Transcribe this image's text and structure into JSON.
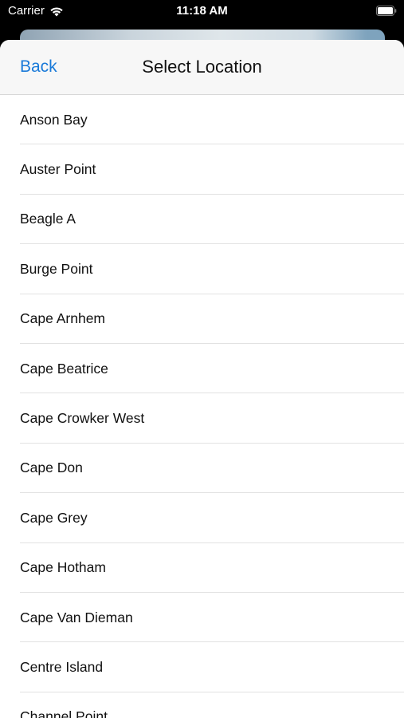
{
  "status_bar": {
    "carrier": "Carrier",
    "time": "11:18 AM"
  },
  "nav": {
    "back_label": "Back",
    "title": "Select Location"
  },
  "locations": [
    "Anson Bay",
    "Auster Point",
    "Beagle A",
    "Burge Point",
    "Cape Arnhem",
    "Cape Beatrice",
    "Cape Crowker West",
    "Cape Don",
    "Cape Grey",
    "Cape Hotham",
    "Cape Van Dieman",
    "Centre Island",
    "Channel Point"
  ],
  "colors": {
    "accent": "#1a7ad9",
    "nav_background": "#f7f7f7",
    "separator": "#e2e2e2"
  }
}
